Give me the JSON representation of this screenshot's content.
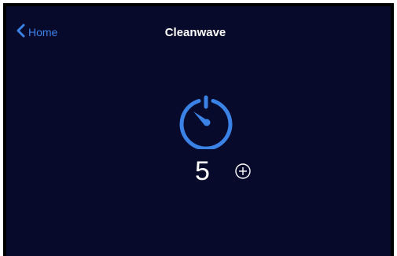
{
  "header": {
    "back_label": "Home",
    "title": "Cleanwave"
  },
  "timer": {
    "icon": "timer-icon",
    "value": "5",
    "increment_icon": "plus-circle-icon"
  },
  "colors": {
    "background": "#070a2b",
    "accent": "#3b82e6",
    "text": "#ffffff",
    "frame": "#000000"
  }
}
